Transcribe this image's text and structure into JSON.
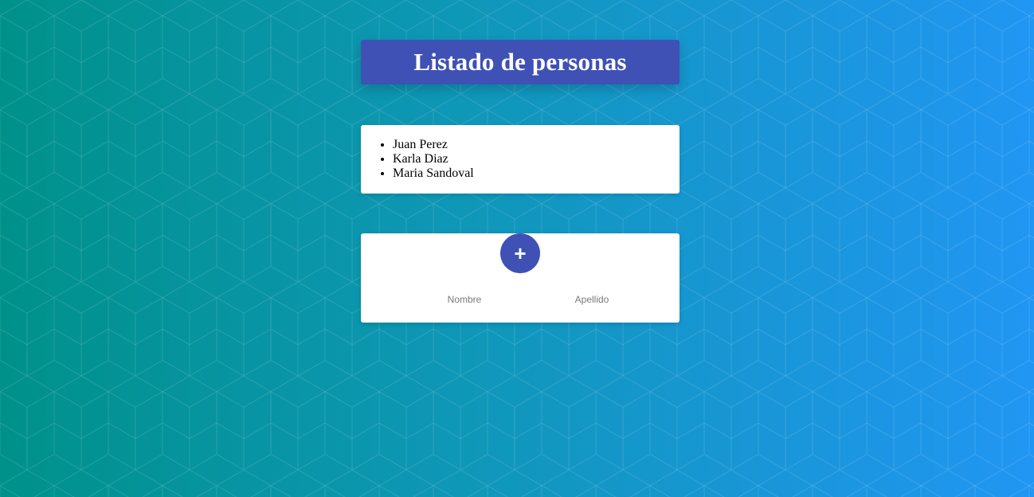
{
  "header": {
    "title": "Listado de personas"
  },
  "people": [
    "Juan Perez",
    "Karla Diaz",
    "Maria Sandoval"
  ],
  "form": {
    "add_button_label": "+",
    "nombre_placeholder": "Nombre",
    "nombre_value": "",
    "apellido_placeholder": "Apellido",
    "apellido_value": ""
  },
  "colors": {
    "accent": "#3f51b5",
    "background_start": "#00918a",
    "background_end": "#2196f3"
  }
}
